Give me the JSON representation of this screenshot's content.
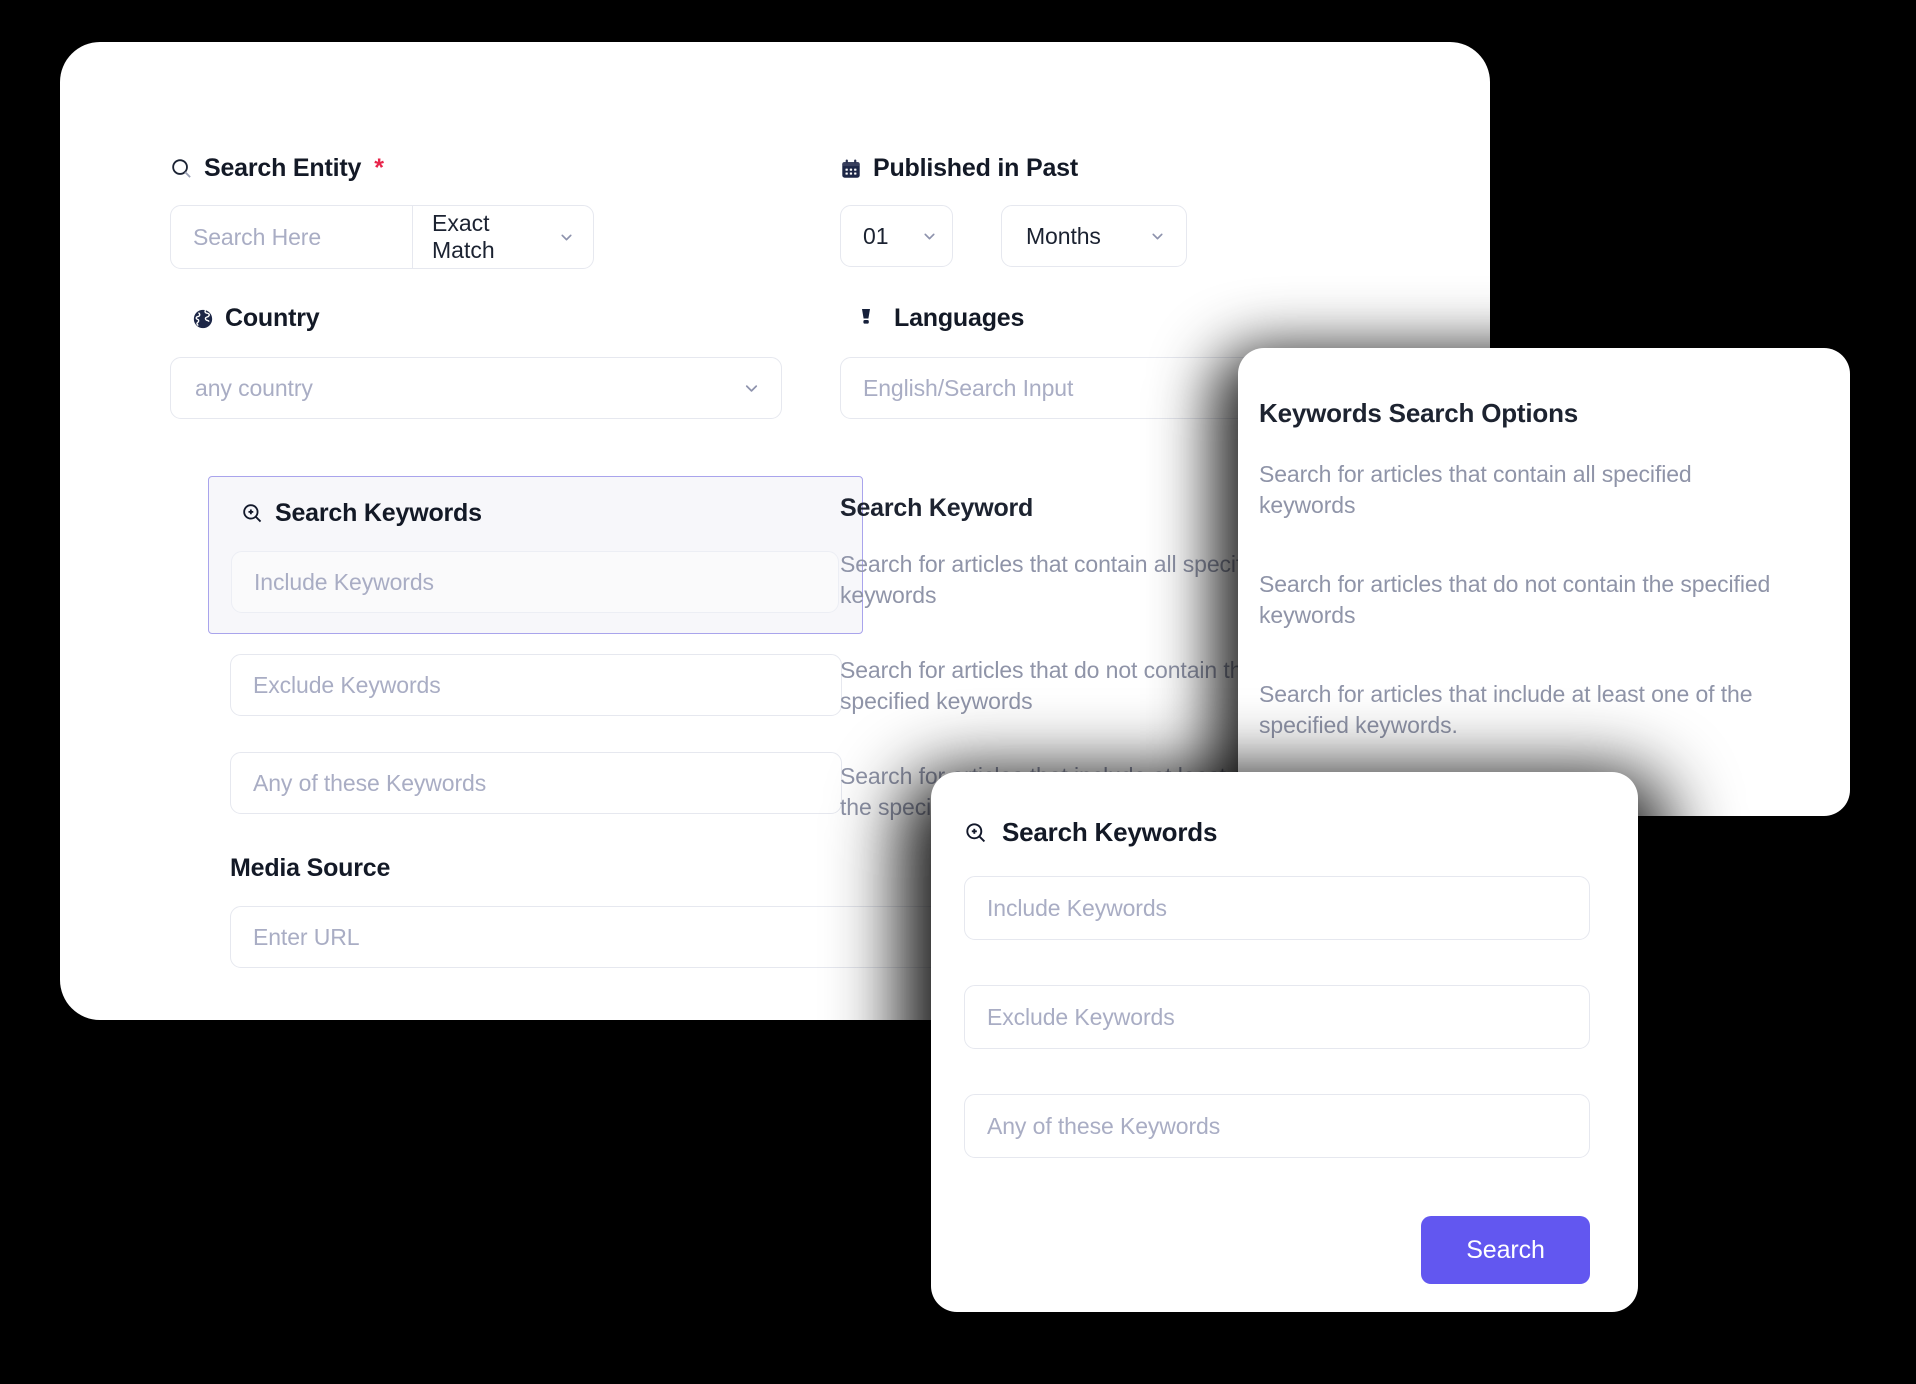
{
  "main_form": {
    "search_entity": {
      "label": "Search Entity",
      "required_mark": "*",
      "icon": "search-icon",
      "input_placeholder": "Search Here",
      "match_mode": "Exact Match"
    },
    "published_in_past": {
      "label": "Published in Past",
      "icon": "calendar-icon",
      "amount": "01",
      "unit": "Months"
    },
    "country": {
      "label": "Country",
      "icon": "globe-icon",
      "placeholder": "any country"
    },
    "languages": {
      "label": "Languages",
      "icon": "language-icon",
      "placeholder": "English/Search Input"
    },
    "search_keywords": {
      "label": "Search Keywords",
      "icon": "zoom-in-icon",
      "include_placeholder": "Include Keywords",
      "exclude_placeholder": "Exclude Keywords",
      "any_placeholder": "Any of these Keywords"
    },
    "media_source": {
      "label": "Media Source",
      "placeholder": "Enter URL"
    }
  },
  "descriptions": {
    "heading": "Search Keyword",
    "items": [
      "Search for articles that contain all specified keywords",
      "Search for articles that do not contain the specified keywords",
      "Search for articles that include at least one of the specified keywords."
    ]
  },
  "options_panel": {
    "title": "Keywords Search Options",
    "items": [
      "Search for articles that contain all specified keywords",
      "Search for articles that do not contain the specified keywords",
      "Search for articles that include at least one of the specified keywords."
    ]
  },
  "modal": {
    "title": "Search Keywords",
    "icon": "zoom-in-icon",
    "include_placeholder": "Include Keywords",
    "exclude_placeholder": "Exclude Keywords",
    "any_placeholder": "Any of these Keywords",
    "search_button": "Search"
  },
  "colors": {
    "accent": "#6257f0",
    "required": "#e8254b",
    "highlight_border": "#a9a4ec",
    "text_dark": "#131926",
    "text_muted": "#8f94a8",
    "placeholder": "#a9adc4"
  }
}
